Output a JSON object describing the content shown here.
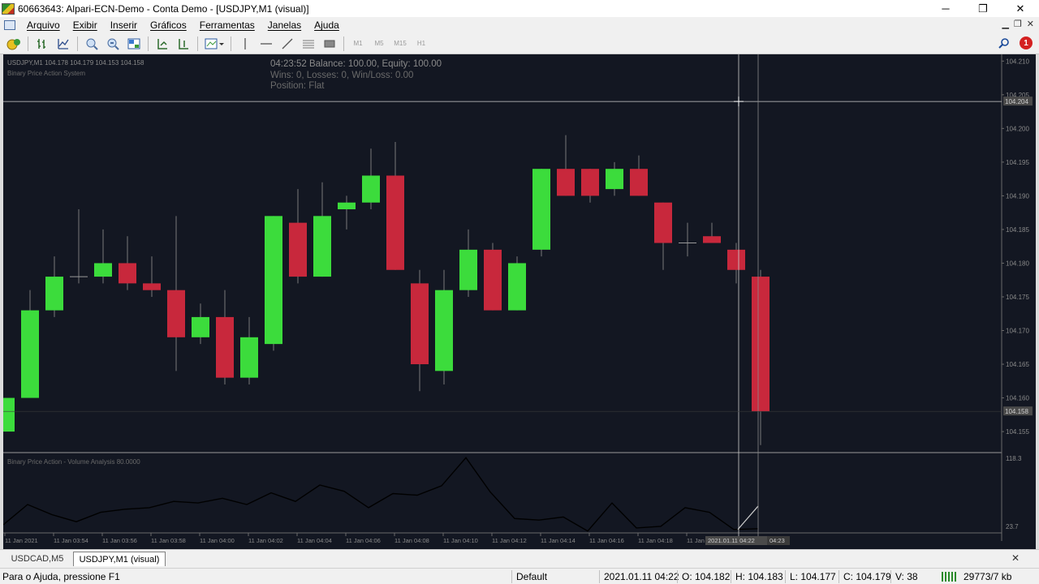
{
  "window": {
    "title": "60663643: Alpari-ECN-Demo - Conta Demo - [USDJPY,M1 (visual)]",
    "minimize": "─",
    "restore": "❐",
    "close": "✕"
  },
  "menu": {
    "items": [
      "Arquivo",
      "Exibir",
      "Inserir",
      "Gráficos",
      "Ferramentas",
      "Janelas",
      "Ajuda"
    ]
  },
  "toolbar": {
    "timeframes": [
      "M1",
      "M5",
      "M15",
      "H1"
    ],
    "notification_count": "1"
  },
  "chart": {
    "symbol_line": "USDJPY,M1  104.178 104.179 104.153 104.158",
    "indicator_name": "Binary Price Action System",
    "info_line1": "04:23:52 Balance: 100.00, Equity: 100.00",
    "info_line2": "Wins: 0, Losses: 0, Win/Loss: 0.00",
    "info_line3": "Position: Flat",
    "subwindow_label": "Binary Price Action - Volume Analysis 80.0000",
    "crosshair_price": "104.204",
    "current_price": "104.158",
    "crosshair_time": "2021.01.11 04:22",
    "last_time_label": "04:23",
    "price_labels": [
      "104.210",
      "104.205",
      "104.200",
      "104.195",
      "104.190",
      "104.185",
      "104.180",
      "104.175",
      "104.170",
      "104.165",
      "104.160",
      "104.155"
    ],
    "vol_labels": [
      "118.3",
      "23.7"
    ],
    "time_labels": [
      "11 Jan 2021",
      "11 Jan 03:54",
      "11 Jan 03:56",
      "11 Jan 03:58",
      "11 Jan 04:00",
      "11 Jan 04:02",
      "11 Jan 04:04",
      "11 Jan 04:06",
      "11 Jan 04:08",
      "11 Jan 04:10",
      "11 Jan 04:12",
      "11 Jan 04:14",
      "11 Jan 04:16",
      "11 Jan 04:18",
      "11 Jan"
    ],
    "colors": {
      "background": "#131722",
      "bull": "#3cdc3c",
      "bear": "#c8283c",
      "wick": "#7a7a7a",
      "text": "#8a8a8a"
    }
  },
  "chart_data": {
    "type": "candlestick",
    "symbol": "USDJPY",
    "timeframe": "M1",
    "candles": [
      {
        "o": 104.155,
        "h": 104.16,
        "l": 104.155,
        "c": 104.16
      },
      {
        "o": 104.16,
        "h": 104.176,
        "l": 104.16,
        "c": 104.173
      },
      {
        "o": 104.173,
        "h": 104.181,
        "l": 104.172,
        "c": 104.178
      },
      {
        "o": 104.178,
        "h": 104.188,
        "l": 104.177,
        "c": 104.178
      },
      {
        "o": 104.178,
        "h": 104.185,
        "l": 104.177,
        "c": 104.18
      },
      {
        "o": 104.18,
        "h": 104.184,
        "l": 104.176,
        "c": 104.177
      },
      {
        "o": 104.177,
        "h": 104.181,
        "l": 104.175,
        "c": 104.176
      },
      {
        "o": 104.176,
        "h": 104.187,
        "l": 104.164,
        "c": 104.169
      },
      {
        "o": 104.169,
        "h": 104.174,
        "l": 104.168,
        "c": 104.172
      },
      {
        "o": 104.172,
        "h": 104.176,
        "l": 104.162,
        "c": 104.163
      },
      {
        "o": 104.163,
        "h": 104.172,
        "l": 104.162,
        "c": 104.169
      },
      {
        "o": 104.168,
        "h": 104.187,
        "l": 104.167,
        "c": 104.187
      },
      {
        "o": 104.186,
        "h": 104.191,
        "l": 104.177,
        "c": 104.178
      },
      {
        "o": 104.178,
        "h": 104.192,
        "l": 104.178,
        "c": 104.187
      },
      {
        "o": 104.188,
        "h": 104.19,
        "l": 104.185,
        "c": 104.189
      },
      {
        "o": 104.189,
        "h": 104.197,
        "l": 104.188,
        "c": 104.193
      },
      {
        "o": 104.193,
        "h": 104.198,
        "l": 104.179,
        "c": 104.179
      },
      {
        "o": 104.177,
        "h": 104.179,
        "l": 104.161,
        "c": 104.165
      },
      {
        "o": 104.164,
        "h": 104.179,
        "l": 104.162,
        "c": 104.176
      },
      {
        "o": 104.176,
        "h": 104.185,
        "l": 104.175,
        "c": 104.182
      },
      {
        "o": 104.182,
        "h": 104.183,
        "l": 104.173,
        "c": 104.173
      },
      {
        "o": 104.173,
        "h": 104.181,
        "l": 104.173,
        "c": 104.18
      },
      {
        "o": 104.182,
        "h": 104.194,
        "l": 104.181,
        "c": 104.194
      },
      {
        "o": 104.194,
        "h": 104.199,
        "l": 104.19,
        "c": 104.19
      },
      {
        "o": 104.194,
        "h": 104.194,
        "l": 104.189,
        "c": 104.19
      },
      {
        "o": 104.191,
        "h": 104.195,
        "l": 104.19,
        "c": 104.194
      },
      {
        "o": 104.194,
        "h": 104.196,
        "l": 104.19,
        "c": 104.19
      },
      {
        "o": 104.189,
        "h": 104.189,
        "l": 104.179,
        "c": 104.183
      },
      {
        "o": 104.183,
        "h": 104.186,
        "l": 104.181,
        "c": 104.183
      },
      {
        "o": 104.184,
        "h": 104.186,
        "l": 104.183,
        "c": 104.183
      },
      {
        "o": 104.182,
        "h": 104.183,
        "l": 104.177,
        "c": 104.179
      },
      {
        "o": 104.178,
        "h": 104.179,
        "l": 104.153,
        "c": 104.158
      }
    ],
    "volume": [
      32,
      58,
      45,
      36,
      48,
      52,
      54,
      62,
      60,
      66,
      58,
      73,
      62,
      83,
      75,
      54,
      72,
      70,
      82,
      118,
      74,
      40,
      38,
      42,
      24,
      60,
      28,
      30,
      54,
      48,
      26,
      27,
      30,
      26,
      56
    ],
    "price_range": [
      104.152,
      104.211
    ],
    "volume_range": [
      23.7,
      118.3
    ]
  }
}
